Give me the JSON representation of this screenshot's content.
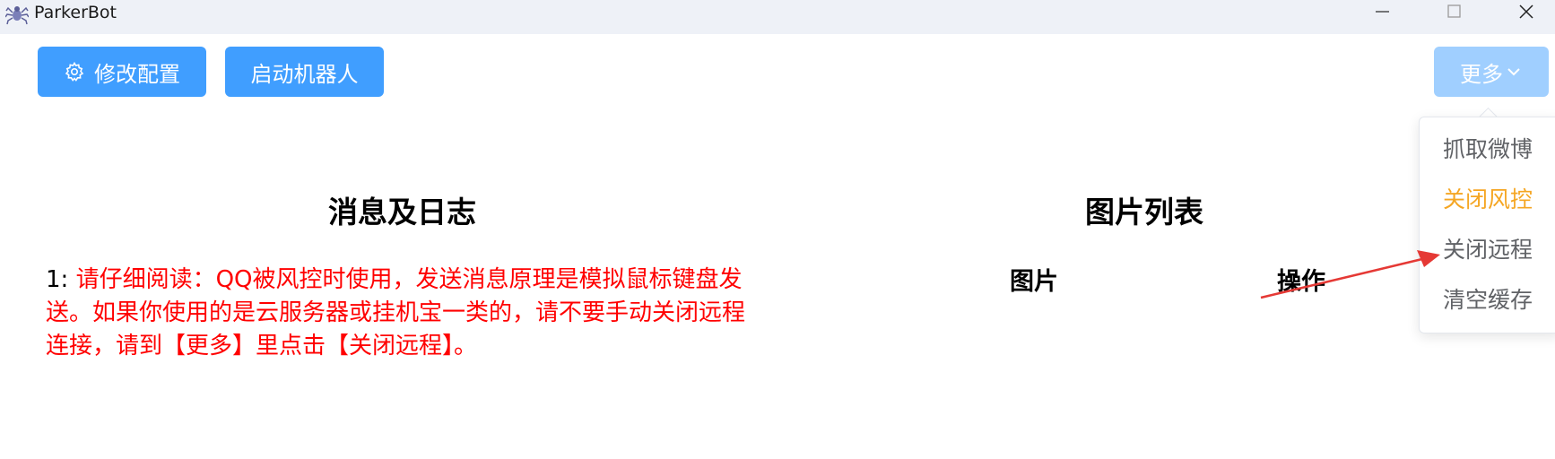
{
  "window": {
    "title": "ParkerBot",
    "app_icon": "spider-icon",
    "controls": [
      "minimize-icon",
      "maximize-icon",
      "close-icon"
    ]
  },
  "toolbar": {
    "config_label": "修改配置",
    "config_icon": "gear-icon",
    "start_label": "启动机器人",
    "more_label": "更多",
    "more_icon": "chevron-down-icon"
  },
  "more_menu": {
    "items": [
      {
        "label": "抓取微博",
        "color": "#606266"
      },
      {
        "label": "关闭风控",
        "color": "#f5a623"
      },
      {
        "label": "关闭远程",
        "color": "#606266"
      },
      {
        "label": "清空缓存",
        "color": "#606266"
      }
    ]
  },
  "log_panel": {
    "title": "消息及日志",
    "entries": [
      {
        "index": "1:",
        "text": "请仔细阅读：QQ被风控时使用，发送消息原理是模拟鼠标键盘发送。如果你使用的是云服务器或挂机宝一类的，请不要手动关闭远程连接，请到【更多】里点击【关闭远程】。",
        "color": "#ff0000"
      }
    ]
  },
  "image_panel": {
    "title": "图片列表",
    "columns": [
      "图片",
      "操作"
    ]
  },
  "colors": {
    "primary": "#409eff",
    "primary_light": "#a0cfff",
    "warning": "#f5a623",
    "annotation_arrow": "#e53935"
  }
}
